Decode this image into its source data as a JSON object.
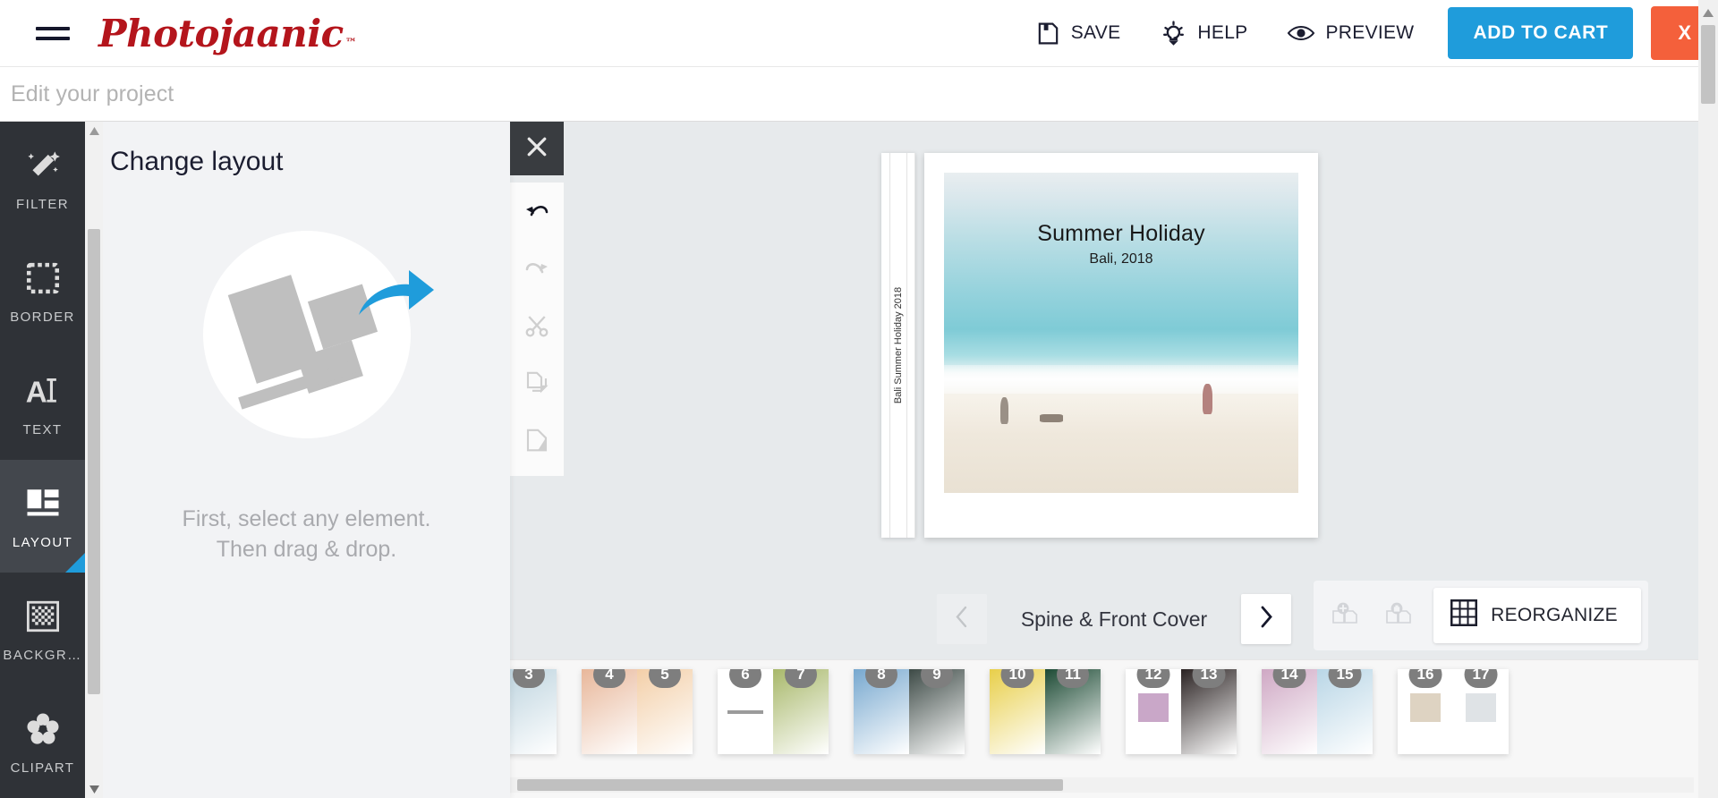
{
  "header": {
    "menu_icon": "hamburger-icon",
    "logo_text": "Photojaanic",
    "logo_tm": "™",
    "actions": [
      {
        "id": "save",
        "label": "SAVE",
        "icon": "floppy-disk-icon"
      },
      {
        "id": "help",
        "label": "HELP",
        "icon": "lightbulb-icon"
      },
      {
        "id": "preview",
        "label": "PREVIEW",
        "icon": "eye-icon"
      }
    ],
    "add_to_cart_label": "ADD TO CART",
    "close_label": "X",
    "accent_blue": "#1f9cdb",
    "accent_orange": "#f4603b",
    "logo_color": "#b4151c"
  },
  "subheader": {
    "project_placeholder": "Edit your project"
  },
  "sidebar": {
    "items": [
      {
        "label": "FILTER",
        "icon": "magic-wand-icon",
        "active": false
      },
      {
        "label": "BORDER",
        "icon": "border-frame-icon",
        "active": false
      },
      {
        "label": "TEXT",
        "icon": "text-cursor-icon",
        "active": false
      },
      {
        "label": "LAYOUT",
        "icon": "layout-grid-icon",
        "active": true
      },
      {
        "label": "BACKGR…",
        "icon": "checkerboard-icon",
        "active": false
      },
      {
        "label": "CLIPART",
        "icon": "flower-icon",
        "active": false
      }
    ]
  },
  "panel": {
    "title": "Change layout",
    "hint_line1": "First, select any element.",
    "hint_line2": "Then drag & drop.",
    "close_icon": "close-x-icon"
  },
  "edit_tools": [
    {
      "id": "undo",
      "icon": "undo-arrow-icon",
      "enabled": true
    },
    {
      "id": "redo",
      "icon": "redo-arrow-icon",
      "enabled": false
    },
    {
      "id": "cut",
      "icon": "scissors-icon",
      "enabled": false
    },
    {
      "id": "copy",
      "icon": "copy-pages-icon",
      "enabled": false
    },
    {
      "id": "paste",
      "icon": "paste-page-icon",
      "enabled": false
    }
  ],
  "canvas": {
    "spine_text": "Bali Summer Holiday 2018",
    "cover_title": "Summer Holiday",
    "cover_subtitle": "Bali, 2018"
  },
  "page_nav": {
    "prev_icon": "chevron-left-icon",
    "next_icon": "chevron-right-icon",
    "current_label": "Spine & Front Cover",
    "prev_enabled": false,
    "next_enabled": true
  },
  "page_tools": {
    "add_page_icon": "add-page-icon",
    "delete_page_icon": "delete-page-icon",
    "reorganize_icon": "grid-icon",
    "reorganize_label": "REORGANIZE"
  },
  "filmstrip": {
    "scroll_down_icon": "chevron-down-icon",
    "spreads": [
      {
        "pages": [
          {
            "num": "3",
            "kind": "photo",
            "tone": "#bcd3de"
          }
        ]
      },
      {
        "pages": [
          {
            "num": "4",
            "kind": "photo",
            "tone": "#e8b79a"
          },
          {
            "num": "5",
            "kind": "photo",
            "tone": "#f3cfa8"
          }
        ]
      },
      {
        "pages": [
          {
            "num": "6",
            "kind": "blank",
            "tone": "#ffffff"
          },
          {
            "num": "7",
            "kind": "photo",
            "tone": "#a8b86a"
          }
        ]
      },
      {
        "pages": [
          {
            "num": "8",
            "kind": "photo",
            "tone": "#77a8cf"
          },
          {
            "num": "9",
            "kind": "photo",
            "tone": "#3d4a46"
          }
        ]
      },
      {
        "pages": [
          {
            "num": "10",
            "kind": "photo",
            "tone": "#e8cf4a"
          },
          {
            "num": "11",
            "kind": "photo",
            "tone": "#1c4a34"
          }
        ]
      },
      {
        "pages": [
          {
            "num": "12",
            "kind": "inset",
            "tone": "#c9a7c8"
          },
          {
            "num": "13",
            "kind": "photo",
            "tone": "#2a2222"
          }
        ]
      },
      {
        "pages": [
          {
            "num": "14",
            "kind": "photo",
            "tone": "#cfa8c4"
          },
          {
            "num": "15",
            "kind": "photo",
            "tone": "#b9d6e6"
          }
        ]
      },
      {
        "pages": [
          {
            "num": "16",
            "kind": "inset",
            "tone": "#ded3c2"
          },
          {
            "num": "17",
            "kind": "inset",
            "tone": "#dfe3e6"
          }
        ]
      }
    ]
  }
}
